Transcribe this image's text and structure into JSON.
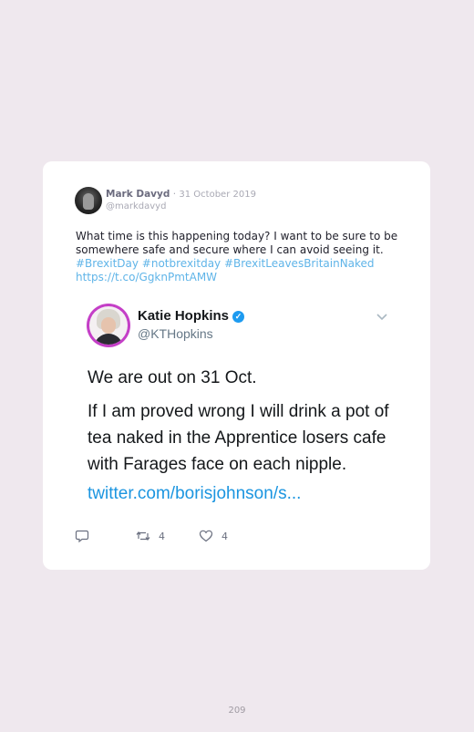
{
  "tweet": {
    "author_name": "Mark Davyd",
    "separator": "·",
    "date": "31 October 2019",
    "handle": "@markdavyd",
    "text_lines": [
      "What time is this happening today? I want to be sure to be",
      "somewhere safe and secure where I can avoid seeing it."
    ],
    "hashtags": "#BrexitDay #notbrexitday #BrexitLeavesBritainNaked",
    "link": "https://t.co/GgknPmtAMW"
  },
  "embedded": {
    "name": "Katie Hopkins",
    "verified_glyph": "✓",
    "handle": "@KTHopkins",
    "paragraph1": "We are out on 31 Oct.",
    "paragraph2_lines": [
      "If I am proved wrong I will drink a pot of",
      "tea naked in the Apprentice losers cafe",
      "with Farages face on each nipple."
    ],
    "link": "twitter.com/borisjohnson/s..."
  },
  "actions": {
    "reply_icon": "reply-icon",
    "retweet_icon": "retweet-icon",
    "retweet_count": "4",
    "like_icon": "heart-icon",
    "like_count": "4"
  },
  "page_number": "209",
  "colors": {
    "background": "#efe8ee",
    "card": "#ffffff",
    "link": "#5fb4e8",
    "embed_link": "#1b95e0",
    "verified": "#1d9bf0",
    "avatar_ring": "#c43fc7"
  }
}
